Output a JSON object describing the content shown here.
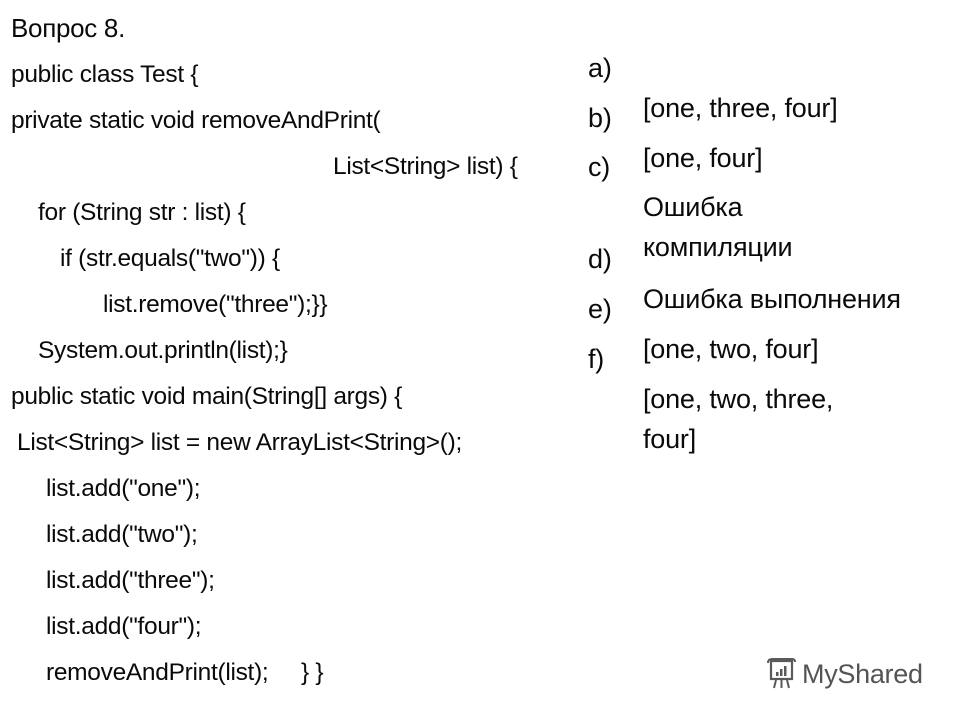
{
  "slide": {
    "title": "Вопрос 8.",
    "code_lines": [
      "public class Test {",
      "private static void removeAndPrint(",
      "List<String> list) {",
      "for (String str : list) {",
      "if (str.equals(\"two\")) {",
      "list.remove(\"three\");}}",
      "System.out.println(list);}",
      "public static void main(String[] args) {",
      "List<String> list = new ArrayList<String>();",
      "list.add(\"one\");",
      "list.add(\"two\");",
      "list.add(\"three\");",
      "list.add(\"four\");",
      "removeAndPrint(list);     } }"
    ],
    "options": [
      {
        "label": "a)",
        "text": "[one, three, four]"
      },
      {
        "label": "b)",
        "text": "[one, four]"
      },
      {
        "label": "c)",
        "text": "Ошибка\nкомпиляции"
      },
      {
        "label": "d)",
        "text": "Ошибка выполнения"
      },
      {
        "label": "e)",
        "text": "[one, two, four]"
      },
      {
        "label": "f)",
        "text": "[one, two, three,\nfour]"
      }
    ]
  },
  "watermark": {
    "icon": "presentation-board-icon",
    "text": "MyShared"
  }
}
